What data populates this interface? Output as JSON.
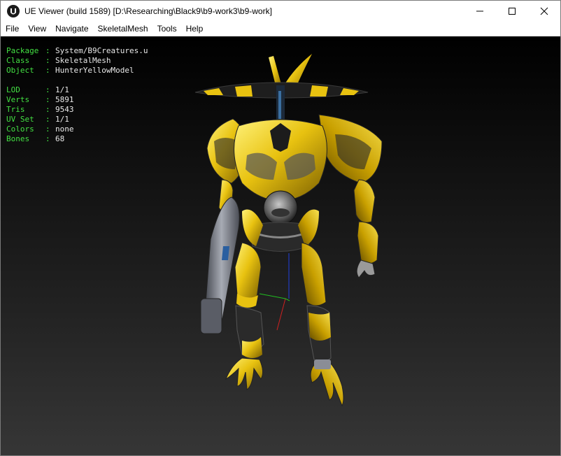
{
  "window": {
    "title": "UE Viewer (build 1589) [D:\\Researching\\Black9\\b9-work3\\b9-work]"
  },
  "menu": [
    {
      "key": "file",
      "label": "File"
    },
    {
      "key": "view",
      "label": "View"
    },
    {
      "key": "navigate",
      "label": "Navigate"
    },
    {
      "key": "skeletalmesh",
      "label": "SkeletalMesh"
    },
    {
      "key": "tools",
      "label": "Tools"
    },
    {
      "key": "help",
      "label": "Help"
    }
  ],
  "info": {
    "package": {
      "key": "Package",
      "value": "System/B9Creatures.u"
    },
    "class": {
      "key": "Class",
      "value": "SkeletalMesh"
    },
    "object": {
      "key": "Object",
      "value": "HunterYellowModel"
    },
    "lod": {
      "key": "LOD",
      "value": "1/1"
    },
    "verts": {
      "key": "Verts",
      "value": "5891"
    },
    "tris": {
      "key": "Tris",
      "value": "9543"
    },
    "uvset": {
      "key": "UV Set",
      "value": "1/1"
    },
    "colors": {
      "key": "Colors",
      "value": "none"
    },
    "bones": {
      "key": "Bones",
      "value": "68"
    },
    "separator": ":"
  },
  "model": {
    "name": "robot-model",
    "accent": "#e8c210",
    "dark": "#1e1e1e",
    "metal": "#8a8d96"
  },
  "colors": {
    "label_green": "#43e043",
    "value_text": "#e8e8e8",
    "axis_x": "#d02020",
    "axis_y": "#20c020",
    "axis_z": "#2040e0"
  }
}
